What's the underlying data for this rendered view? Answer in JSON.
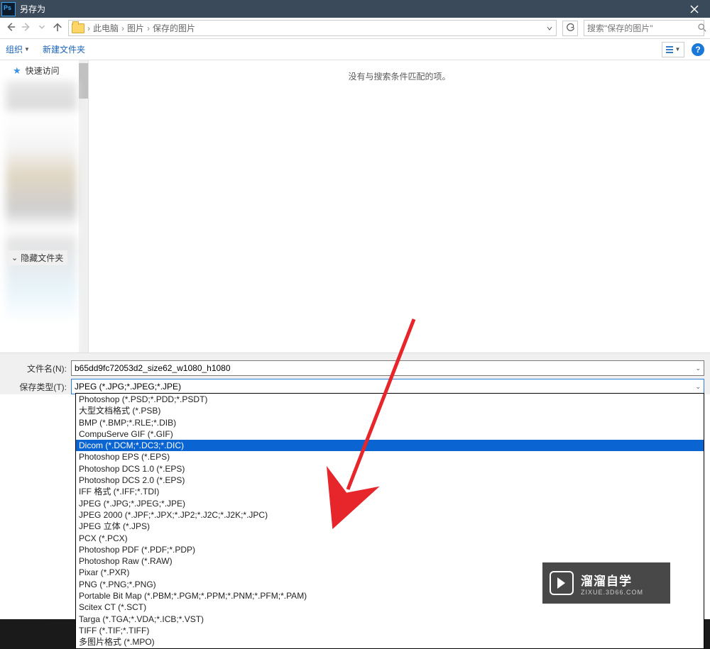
{
  "title": "另存为",
  "breadcrumbs": {
    "root": "此电脑",
    "l1": "图片",
    "l2": "保存的图片"
  },
  "search_placeholder": "搜索\"保存的图片\"",
  "cmd": {
    "organize": "组织",
    "newfolder": "新建文件夹"
  },
  "help_symbol": "?",
  "sidebar": {
    "quick_access": "快速访问"
  },
  "empty_msg": "没有与搜索条件匹配的项。",
  "form": {
    "filename_label": "文件名(N):",
    "filename_value": "b65dd9fc72053d2_size62_w1080_h1080",
    "filetype_label": "保存类型(T):",
    "filetype_value": "JPEG (*.JPG;*.JPEG;*.JPE)"
  },
  "hide_files": "隐藏文件夹",
  "types": [
    "Photoshop (*.PSD;*.PDD;*.PSDT)",
    "大型文档格式 (*.PSB)",
    "BMP (*.BMP;*.RLE;*.DIB)",
    "CompuServe GIF (*.GIF)",
    "Dicom (*.DCM;*.DC3;*.DIC)",
    "Photoshop EPS (*.EPS)",
    "Photoshop DCS 1.0 (*.EPS)",
    "Photoshop DCS 2.0 (*.EPS)",
    "IFF 格式 (*.IFF;*.TDI)",
    "JPEG (*.JPG;*.JPEG;*.JPE)",
    "JPEG 2000 (*.JPF;*.JPX;*.JP2;*.J2C;*.J2K;*.JPC)",
    "JPEG 立体 (*.JPS)",
    "PCX (*.PCX)",
    "Photoshop PDF (*.PDF;*.PDP)",
    "Photoshop Raw (*.RAW)",
    "Pixar (*.PXR)",
    "PNG (*.PNG;*.PNG)",
    "Portable Bit Map (*.PBM;*.PGM;*.PPM;*.PNM;*.PFM;*.PAM)",
    "Scitex CT (*.SCT)",
    "Targa (*.TGA;*.VDA;*.ICB;*.VST)",
    "TIFF (*.TIF;*.TIFF)",
    "多图片格式 (*.MPO)"
  ],
  "selected_type_index": 4,
  "bg": {
    "zoom": "66.67%"
  },
  "watermark": {
    "cn": "溜溜自学",
    "en": "ZIXUE.3D66.COM"
  }
}
